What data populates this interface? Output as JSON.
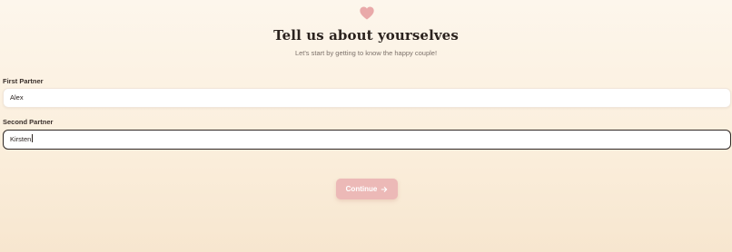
{
  "header": {
    "icon": "heart-icon",
    "title": "Tell us about yourselves",
    "subtitle": "Let's start by getting to know the happy couple!"
  },
  "form": {
    "first_partner": {
      "label": "First Partner",
      "value": "Alex"
    },
    "second_partner": {
      "label": "Second Partner",
      "value": "Kirsten"
    }
  },
  "actions": {
    "continue_label": "Continue",
    "continue_icon": "arrow-right-icon"
  },
  "colors": {
    "background_top": "#fdf6ec",
    "background_bottom": "#f7e6cf",
    "accent_pink": "#ecb9b7",
    "heart": "#e9a9a9",
    "focused_border": "#2f2724"
  }
}
